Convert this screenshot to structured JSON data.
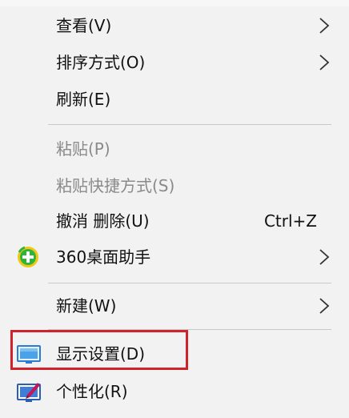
{
  "menu": {
    "items": [
      {
        "label": "查看(V)",
        "submenu": true
      },
      {
        "label": "排序方式(O)",
        "submenu": true
      },
      {
        "label": "刷新(E)"
      },
      {
        "label": "粘贴(P)",
        "disabled": true
      },
      {
        "label": "粘贴快捷方式(S)",
        "disabled": true
      },
      {
        "label": "撤消 删除(U)",
        "shortcut": "Ctrl+Z"
      },
      {
        "label": "360桌面助手",
        "icon": "360-assistant-icon",
        "submenu": true
      },
      {
        "label": "新建(W)",
        "submenu": true
      },
      {
        "label": "显示设置(D)",
        "icon": "display-settings-icon",
        "highlighted": true
      },
      {
        "label": "个性化(R)",
        "icon": "personalize-icon"
      }
    ]
  },
  "colors": {
    "menu_background": "#f2f2f2",
    "separator": "#c9c9c9",
    "disabled_text": "#8a8a8a",
    "highlight_border": "#d0222b",
    "green_icon": "#2fb43a",
    "yellow_ring": "#f3c716"
  }
}
